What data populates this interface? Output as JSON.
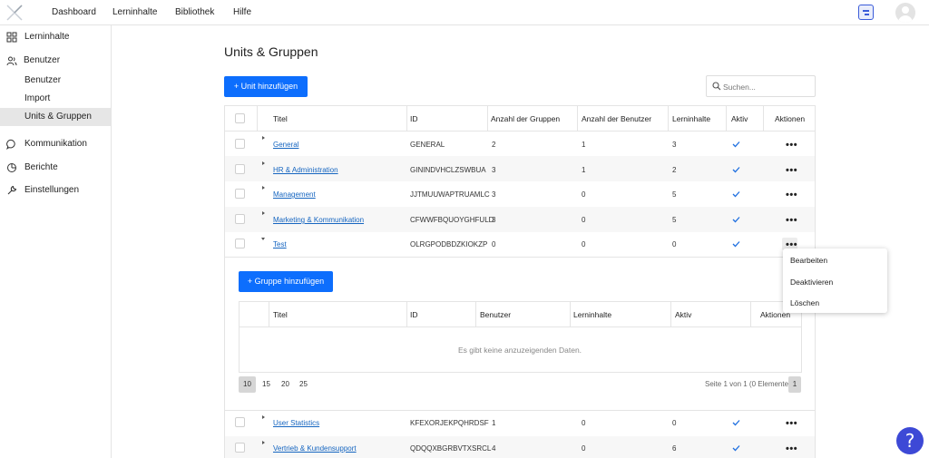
{
  "topbar": {
    "nav": [
      "Dashboard",
      "Lerninhalte",
      "Bibliothek",
      "Hilfe"
    ]
  },
  "sidebar": {
    "items": [
      {
        "label": "Lerninhalte",
        "icon": "grid-icon"
      },
      {
        "label": "Benutzer",
        "icon": "users-icon"
      },
      {
        "label": "Benutzer"
      },
      {
        "label": "Import"
      },
      {
        "label": "Units & Gruppen",
        "active": true
      },
      {
        "label": "Kommunikation",
        "icon": "chat-bubble-icon"
      },
      {
        "label": "Berichte",
        "icon": "pie-chart-icon"
      },
      {
        "label": "Einstellungen",
        "icon": "wrench-icon"
      }
    ]
  },
  "main": {
    "title": "Units & Gruppen",
    "add_unit": "+ Unit hinzufügen",
    "search_placeholder": "Suchen...",
    "columns": [
      "Titel",
      "ID",
      "Anzahl der Gruppen",
      "Anzahl der Benutzer",
      "Lerninhalte",
      "Aktiv",
      "Aktionen"
    ],
    "rows": [
      {
        "title": "General",
        "id": "GENERAL",
        "groups": "2",
        "users": "1",
        "content": "3",
        "active": true
      },
      {
        "title": "HR & Administration",
        "id": "GININDVHCLZSWBUA",
        "groups": "3",
        "users": "1",
        "content": "2",
        "active": true
      },
      {
        "title": "Management",
        "id": "JJTMUUWAPTRUAMLC",
        "groups": "3",
        "users": "0",
        "content": "5",
        "active": true
      },
      {
        "title": "Marketing & Kommunikation",
        "id": "CFWWFBQUOYGHFULD",
        "groups": "3",
        "users": "0",
        "content": "5",
        "active": true
      },
      {
        "title": "Test",
        "id": "OLRGPODBDZKIOKZP",
        "groups": "0",
        "users": "0",
        "content": "0",
        "active": true
      }
    ],
    "rows_after": [
      {
        "title": "User Statistics",
        "id": "KFEXORJEKPQHRDSF",
        "groups": "1",
        "users": "0",
        "content": "0",
        "active": true
      },
      {
        "title": "Vertrieb & Kundensupport",
        "id": "QDQQXBGRBVTXSRCL",
        "groups": "4",
        "users": "0",
        "content": "6",
        "active": true
      }
    ],
    "actions_menu": [
      "Bearbeiten",
      "Deaktivieren",
      "Löschen"
    ],
    "subtable": {
      "add_group": "+ Gruppe hinzufügen",
      "columns": [
        "Titel",
        "ID",
        "Benutzer",
        "Lerninhalte",
        "Aktiv",
        "Aktionen"
      ],
      "empty_text": "Es gibt keine anzuzeigenden Daten.",
      "page_sizes": [
        "10",
        "15",
        "20",
        "25"
      ],
      "page_info": "Seite 1 von 1 (0 Elemente)",
      "current_page": "1"
    }
  },
  "help_label": "?"
}
